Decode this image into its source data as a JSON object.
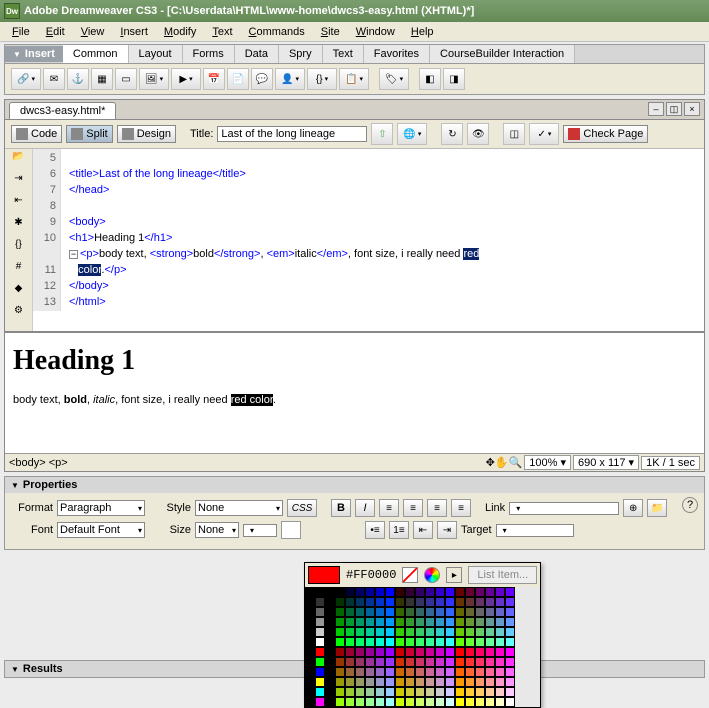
{
  "title": "Adobe Dreamweaver CS3 - [C:\\Userdata\\HTML\\www-home\\dwcs3-easy.html (XHTML)*]",
  "dw_icon": "Dw",
  "menu": [
    "File",
    "Edit",
    "View",
    "Insert",
    "Modify",
    "Text",
    "Commands",
    "Site",
    "Window",
    "Help"
  ],
  "insert": {
    "label": "Insert",
    "tabs": [
      "Common",
      "Layout",
      "Forms",
      "Data",
      "Spry",
      "Text",
      "Favorites",
      "CourseBuilder Interaction"
    ],
    "active": 0
  },
  "doc_tab": "dwcs3-easy.html*",
  "views": {
    "code": "Code",
    "split": "Split",
    "design": "Design"
  },
  "title_label": "Title:",
  "page_title": "Last of the long lineage",
  "check_page": "Check Page",
  "code": {
    "lines": [
      5,
      6,
      7,
      8,
      9,
      10,
      "",
      11,
      12,
      13
    ],
    "l5": "<title>Last of the long lineage</title>",
    "l6": "</head>",
    "l7": "",
    "l8": "<body>",
    "l9_open": "<h1>",
    "l9_txt": "Heading 1",
    "l9_close": "</h1>",
    "l10_a": "<p>",
    "l10_b": "body text, ",
    "l10_c": "<strong>",
    "l10_d": "bold",
    "l10_e": "</strong>",
    "l10_f": ", ",
    "l10_g": "<em>",
    "l10_h": "italic",
    "l10_i": "</em>",
    "l10_j": ", font size, i really need ",
    "l10_k": "red",
    "l10x_a": "color",
    "l10x_b": ".",
    "l10x_c": "</p>",
    "l11": "</body>",
    "l12": "</html>",
    "l13": ""
  },
  "design": {
    "h1": "Heading 1",
    "p1": "body text, ",
    "bold": "bold",
    "c1": ", ",
    "italic": "italic",
    "c2": ", font size, i really need ",
    "hl": "red color",
    "dot": "."
  },
  "status": {
    "path": "<body> <p>",
    "zoom": "100%",
    "dims": "690 x 117",
    "size": "1K / 1 sec"
  },
  "props": {
    "header": "Properties",
    "format_label": "Format",
    "format_val": "Paragraph",
    "style_label": "Style",
    "style_val": "None",
    "css": "CSS",
    "B": "B",
    "I": "I",
    "link_label": "Link",
    "font_label": "Font",
    "font_val": "Default Font",
    "size_label": "Size",
    "size_val": "None",
    "target_label": "Target",
    "list_item": "List Item..."
  },
  "picker": {
    "hex": "#FF0000"
  },
  "results": "Results"
}
